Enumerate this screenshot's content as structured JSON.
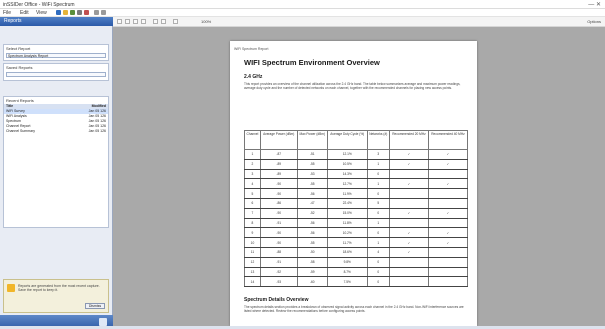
{
  "window": {
    "title": "inSSIDer Office - WiFi Spectrum",
    "controls": "— ✕"
  },
  "menu": {
    "items": [
      "File",
      "Edit",
      "View"
    ]
  },
  "sidebar": {
    "header": "Reports",
    "select_label": "Select Report",
    "select_value": "Spectrum Analysis Report",
    "filter_label": "Saved Reports",
    "filter_value": "",
    "list_label": "Recent Reports",
    "list_header": [
      "Title",
      "Modified"
    ],
    "list_rows": [
      [
        "WiFi Survey",
        "Jan 05 126"
      ],
      [
        "WiFi Analysis",
        "Jan 05 126"
      ],
      [
        "Spectrum",
        "Jan 05 126"
      ],
      [
        "Channel Report",
        "Jan 05 126"
      ],
      [
        "Channel Summary",
        "Jan 05 126"
      ]
    ],
    "notice": "Reports are generated from the most recent capture. Save the report to keep it.",
    "notice_button": "Dismiss"
  },
  "toolbar": {
    "zoom": "100%",
    "right_label": "Options"
  },
  "document": {
    "header": "WiFi Spectrum Report",
    "title": "WIFI Spectrum Environment Overview",
    "section1": "2.4 GHz",
    "para1": "This report provides an overview of the channel utilization across the 2.4 GHz band. The table below summarizes average and maximum power readings, average duty cycle and the number of detected networks on each channel, together with the recommended channels for placing new access points.",
    "columns": [
      "Channel",
      "Average Power (dBm)",
      "Max Power (dBm)",
      "Average Duty Cycle (%)",
      "Networks (#)",
      "Recommended 20 MHz",
      "Recommended 40 MHz"
    ],
    "rows": [
      [
        "1",
        "-87",
        "-51",
        "12.1%",
        "3",
        "✓",
        "✓"
      ],
      [
        "2",
        "-89",
        "-55",
        "10.5%",
        "1",
        "✓",
        "✓"
      ],
      [
        "3",
        "-89",
        "-53",
        "14.3%",
        "0",
        "",
        ""
      ],
      [
        "4",
        "-90",
        "-55",
        "12.7%",
        "1",
        "✓",
        "✓"
      ],
      [
        "5",
        "-90",
        "-56",
        "11.9%",
        "0",
        "",
        ""
      ],
      [
        "6",
        "-86",
        "-47",
        "22.4%",
        "5",
        "",
        ""
      ],
      [
        "7",
        "-90",
        "-52",
        "15.0%",
        "0",
        "✓",
        "✓"
      ],
      [
        "8",
        "-91",
        "-56",
        "11.8%",
        "1",
        "",
        ""
      ],
      [
        "9",
        "-90",
        "-56",
        "10.2%",
        "0",
        "✓",
        "✓"
      ],
      [
        "10",
        "-90",
        "-55",
        "11.7%",
        "1",
        "✓",
        "✓"
      ],
      [
        "11",
        "-88",
        "-50",
        "18.6%",
        "4",
        "✓",
        ""
      ],
      [
        "12",
        "-91",
        "-58",
        "9.8%",
        "0",
        "",
        ""
      ],
      [
        "13",
        "-92",
        "-59",
        "8.7%",
        "0",
        "",
        ""
      ],
      [
        "14",
        "-93",
        "-60",
        "7.5%",
        "0",
        "",
        ""
      ]
    ],
    "section2": "Spectrum Details Overview",
    "para2": "The spectrum details section provides a breakdown of observed signal activity across each channel in the 2.4 GHz band. Non-WiFi interference sources are listed where detected. Review the recommendations before configuring access points."
  }
}
